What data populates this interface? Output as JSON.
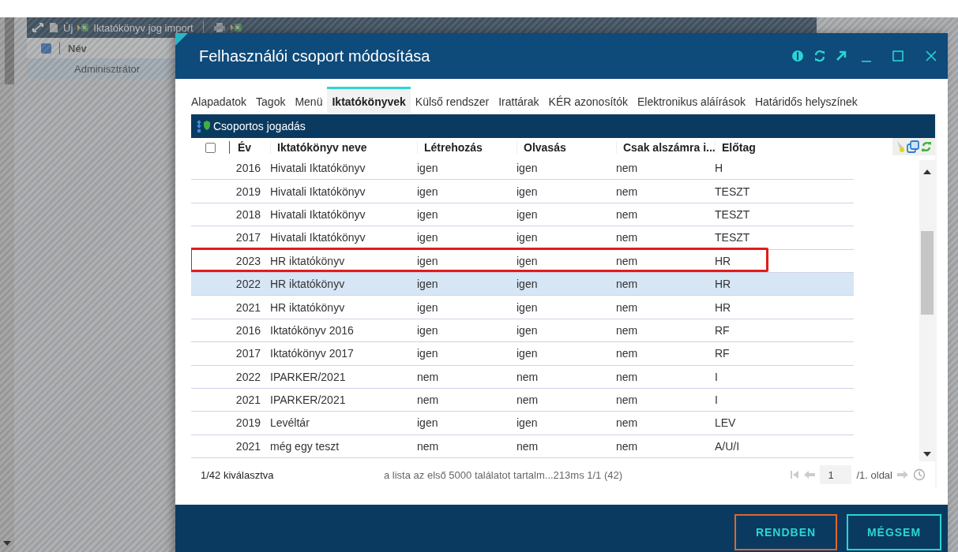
{
  "background": {
    "toolbar": {
      "new_label": "Új",
      "import_label": "Iktatókönyv jog import"
    },
    "list": {
      "column": "Név",
      "select_all_checked": true,
      "rows": [
        {
          "name": "Adminisztrátor",
          "selected": true
        }
      ]
    }
  },
  "dialog": {
    "title": "Felhasználói csoport módosítása",
    "tabs": [
      {
        "label": "Alapadatok",
        "selected": false
      },
      {
        "label": "Tagok",
        "selected": false
      },
      {
        "label": "Menü",
        "selected": false
      },
      {
        "label": "Iktatókönyvek",
        "selected": true
      },
      {
        "label": "Külső rendszer",
        "selected": false
      },
      {
        "label": "Irattárak",
        "selected": false
      },
      {
        "label": "KÉR azonosítók",
        "selected": false
      },
      {
        "label": "Elektronikus aláírások",
        "selected": false
      },
      {
        "label": "Határidős helyszínek",
        "selected": false
      }
    ],
    "group_bar": "Csoportos jogadás",
    "table": {
      "select_all_checked": false,
      "columns": [
        "Év",
        "Iktatókönyv neve",
        "Létrehozás",
        "Olvasás",
        "Csak alszámra i...",
        "Előtag"
      ],
      "rows": [
        {
          "cells": [
            "2016",
            "Hivatali Iktatókönyv",
            "igen",
            "igen",
            "nem",
            "H"
          ],
          "selected": false,
          "marked": false
        },
        {
          "cells": [
            "2019",
            "Hivatali Iktatókönyv",
            "igen",
            "igen",
            "nem",
            "TESZT"
          ],
          "selected": false,
          "marked": false
        },
        {
          "cells": [
            "2018",
            "Hivatali Iktatókönyv",
            "igen",
            "igen",
            "nem",
            "TESZT"
          ],
          "selected": false,
          "marked": false
        },
        {
          "cells": [
            "2017",
            "Hivatali Iktatókönyv",
            "igen",
            "igen",
            "nem",
            "TESZT"
          ],
          "selected": false,
          "marked": false
        },
        {
          "cells": [
            "2023",
            "HR iktatókönyv",
            "igen",
            "igen",
            "nem",
            "HR"
          ],
          "selected": false,
          "marked": true
        },
        {
          "cells": [
            "2022",
            "HR iktatókönyv",
            "igen",
            "igen",
            "nem",
            "HR"
          ],
          "selected": true,
          "marked": false
        },
        {
          "cells": [
            "2021",
            "HR iktatókönyv",
            "igen",
            "igen",
            "nem",
            "HR"
          ],
          "selected": false,
          "marked": false
        },
        {
          "cells": [
            "2016",
            "Iktatókönyv 2016",
            "igen",
            "igen",
            "nem",
            "RF"
          ],
          "selected": false,
          "marked": false
        },
        {
          "cells": [
            "2017",
            "Iktatókönyv 2017",
            "igen",
            "igen",
            "nem",
            "RF"
          ],
          "selected": false,
          "marked": false
        },
        {
          "cells": [
            "2022",
            "IPARKER/2021",
            "nem",
            "nem",
            "nem",
            "I"
          ],
          "selected": false,
          "marked": false
        },
        {
          "cells": [
            "2021",
            "IPARKER/2021",
            "nem",
            "nem",
            "nem",
            "I"
          ],
          "selected": false,
          "marked": false
        },
        {
          "cells": [
            "2019",
            "Levéltár",
            "igen",
            "igen",
            "nem",
            "LEV"
          ],
          "selected": false,
          "marked": false
        },
        {
          "cells": [
            "2021",
            "még egy teszt",
            "nem",
            "nem",
            "nem",
            "A/U/I"
          ],
          "selected": false,
          "marked": false
        }
      ]
    },
    "status": "1/42 kiválasztva",
    "info": "a lista az első 5000 találatot tartalm...213ms 1/1 (42)",
    "page": "1",
    "page_total": "/1. oldal",
    "buttons": [
      {
        "label": "RENDBEN",
        "focused": true
      },
      {
        "label": "MÉGSEM",
        "focused": false
      }
    ]
  }
}
